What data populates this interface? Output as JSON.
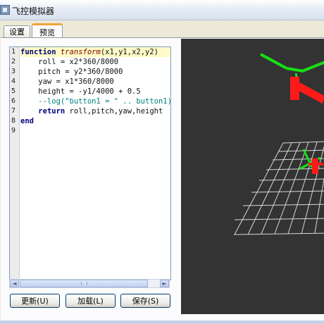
{
  "window": {
    "title": "飞控模拟器"
  },
  "tabs": [
    {
      "label": "设置"
    },
    {
      "label": "预览",
      "active": true
    }
  ],
  "editor": {
    "line_numbers": [
      "1",
      "2",
      "3",
      "4",
      "5",
      "6",
      "7",
      "8",
      "9"
    ],
    "code": [
      {
        "parts": [
          {
            "t": "function",
            "c": "kw"
          },
          {
            "t": " ",
            "c": ""
          },
          {
            "t": "transform",
            "c": "fn"
          },
          {
            "t": "(x1,y1,x2,y2)",
            "c": ""
          }
        ],
        "highlight": true
      },
      {
        "parts": [
          {
            "t": "    roll = x2*360/8000",
            "c": ""
          }
        ]
      },
      {
        "parts": [
          {
            "t": "    pitch = y2*360/8000",
            "c": ""
          }
        ]
      },
      {
        "parts": [
          {
            "t": "    yaw = x1*360/8000",
            "c": ""
          }
        ]
      },
      {
        "parts": [
          {
            "t": "    height = -y1/4000 + 0.5",
            "c": ""
          }
        ]
      },
      {
        "parts": [
          {
            "t": "    --log(\"button1 = \" .. button1)",
            "c": "cm"
          }
        ]
      },
      {
        "parts": [
          {
            "t": "    ",
            "c": ""
          },
          {
            "t": "return",
            "c": "kw"
          },
          {
            "t": " roll,pitch,yaw,height",
            "c": ""
          }
        ]
      },
      {
        "parts": [
          {
            "t": "end",
            "c": "kw"
          }
        ]
      },
      {
        "parts": []
      }
    ]
  },
  "buttons": {
    "update": "更新(U)",
    "load": "加载(L)",
    "save": "保存(S)"
  },
  "scrollbar": {
    "left_arrow": "◄",
    "right_arrow": "►"
  },
  "colors": {
    "viewport_bg": "#333333",
    "grid": "#d8d8d8",
    "model_green": "#16e016",
    "model_red": "#ff1a1a"
  }
}
